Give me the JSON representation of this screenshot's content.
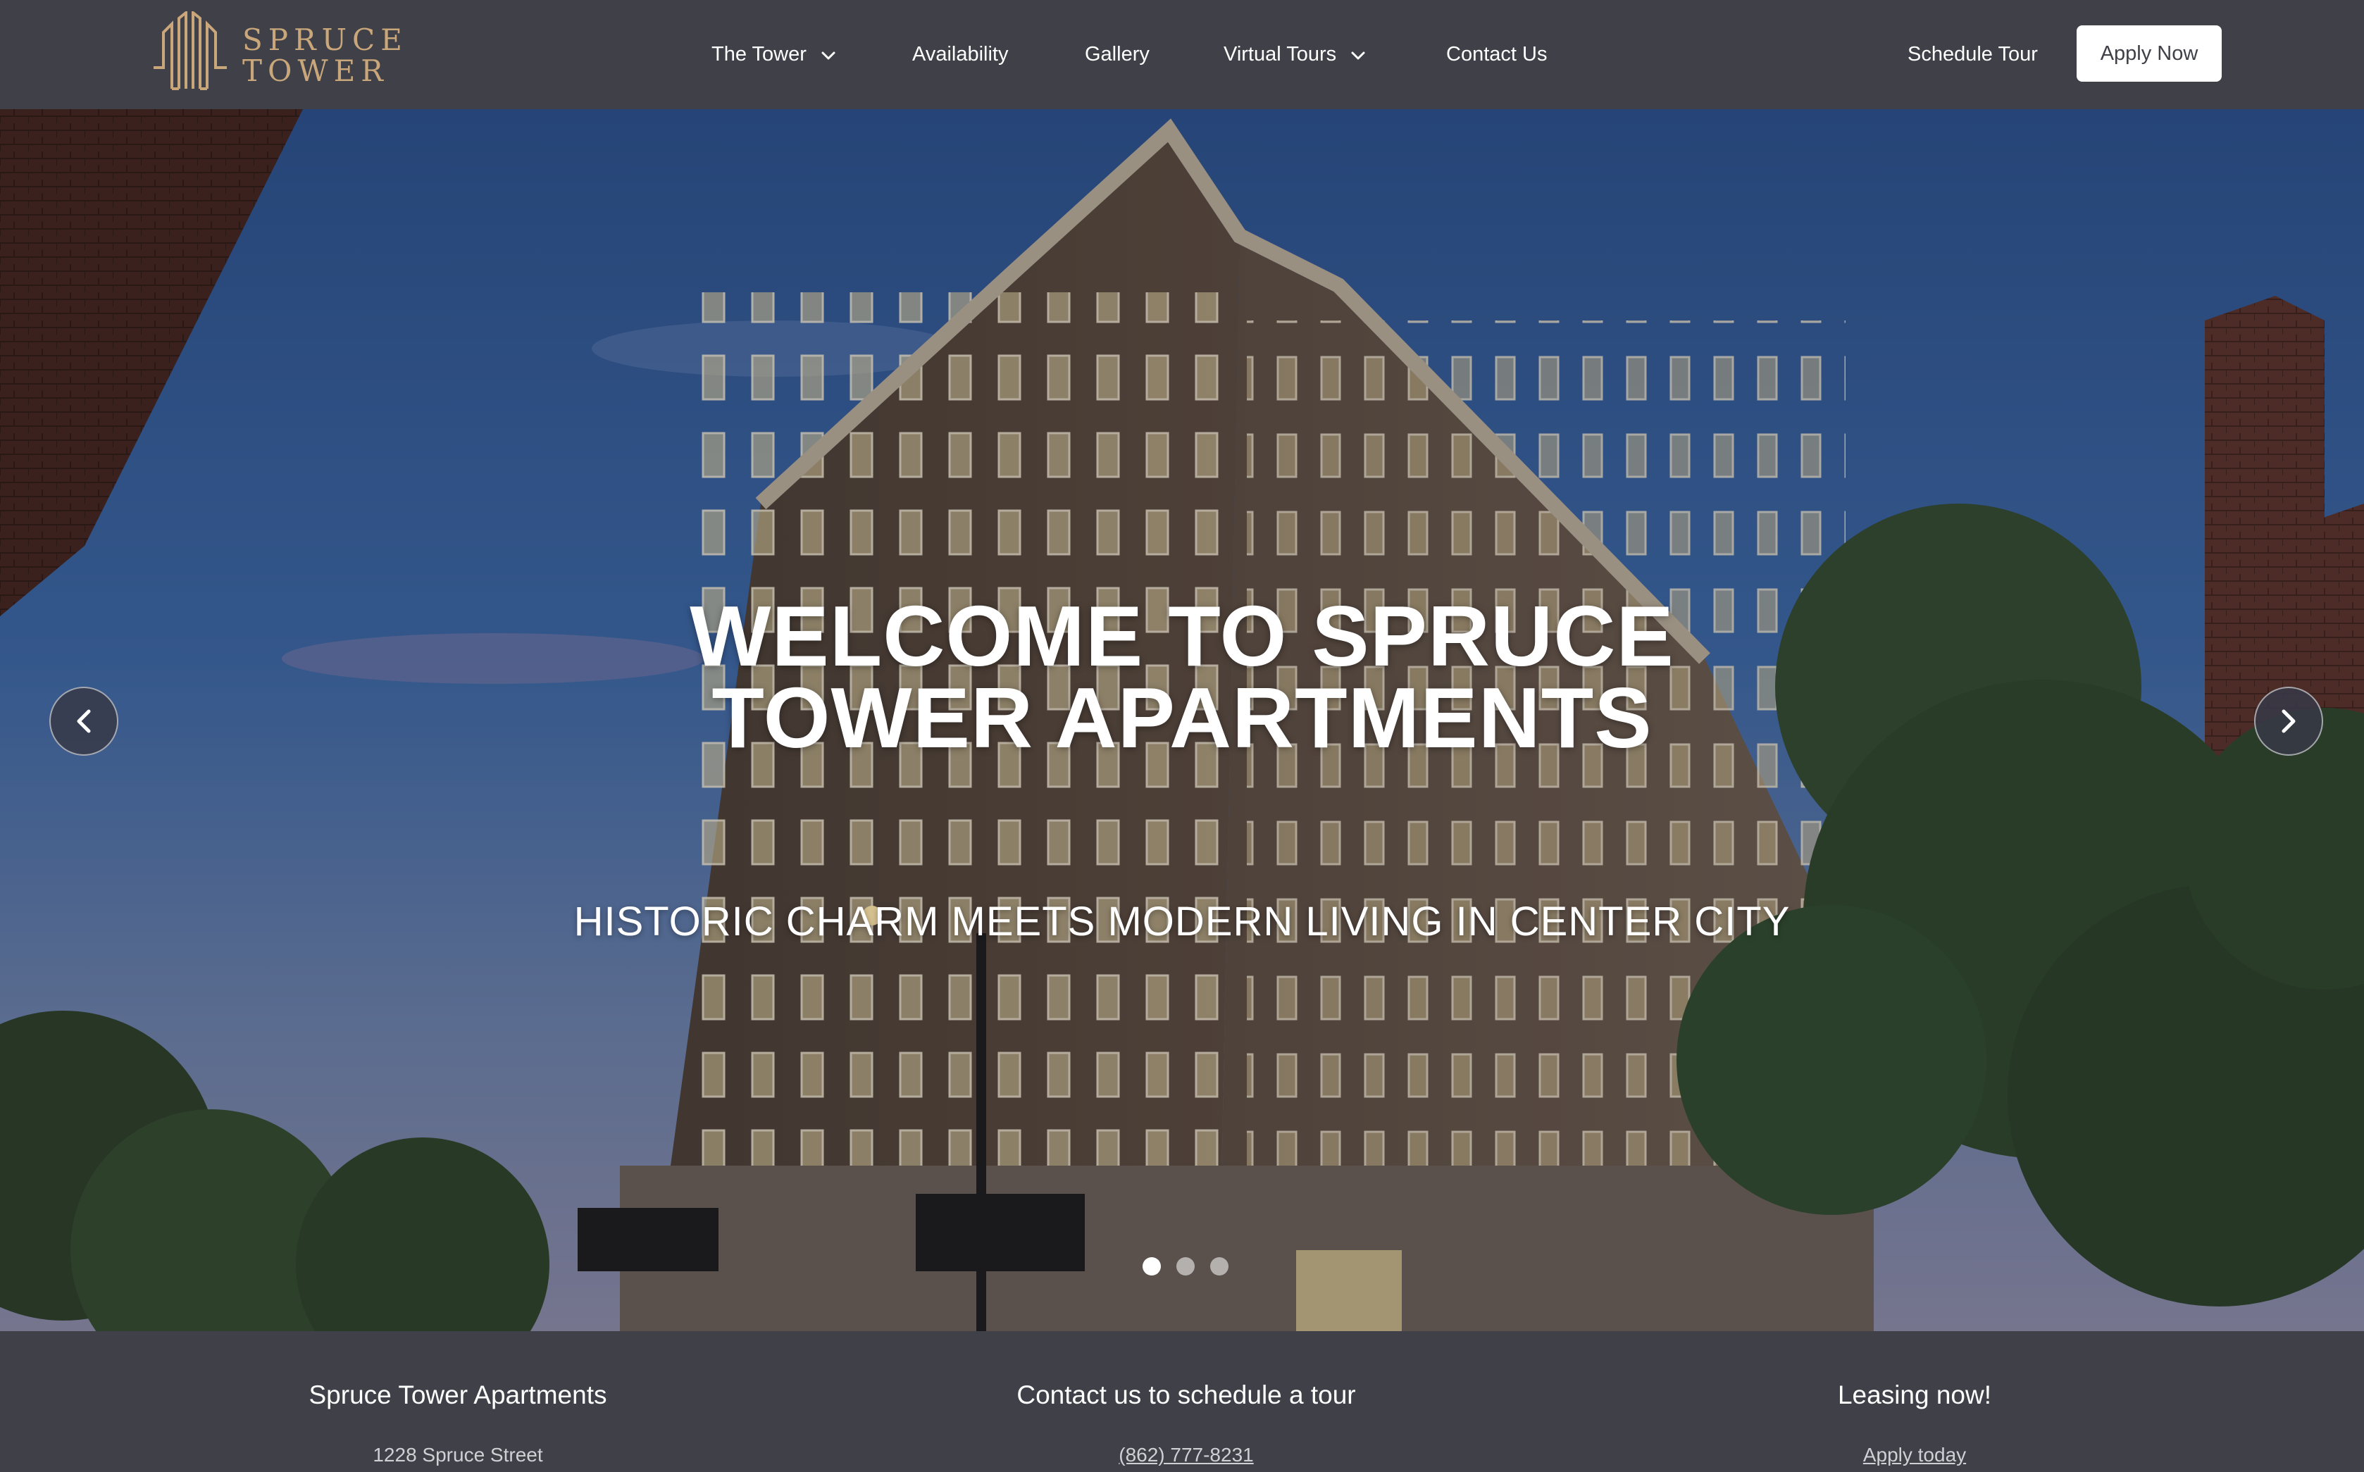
{
  "brand": {
    "line1": "SPRUCE",
    "line2": "TOWER",
    "color": "#c9a77b"
  },
  "nav": {
    "items": [
      {
        "label": "The Tower",
        "has_dropdown": true
      },
      {
        "label": "Availability",
        "has_dropdown": false
      },
      {
        "label": "Gallery",
        "has_dropdown": false
      },
      {
        "label": "Virtual Tours",
        "has_dropdown": true
      },
      {
        "label": "Contact Us",
        "has_dropdown": false
      }
    ],
    "schedule_label": "Schedule Tour",
    "apply_label": "Apply Now"
  },
  "hero": {
    "title_line1": "WELCOME TO SPRUCE",
    "title_line2": "TOWER APARTMENTS",
    "subtitle": "HISTORIC CHARM MEETS MODERN LIVING IN CENTER CITY",
    "slide_count": 3,
    "active_slide": 1
  },
  "info": {
    "col1": {
      "heading": "Spruce Tower Apartments",
      "line": "1228 Spruce Street"
    },
    "col2": {
      "heading": "Contact us to schedule a tour",
      "line": "(862) 777-8231"
    },
    "col3": {
      "heading": "Leasing now!",
      "line": "Apply today"
    }
  },
  "colors": {
    "nav_bg": "#3f4048",
    "accent": "#c9a77b",
    "sky": "#31578f"
  }
}
